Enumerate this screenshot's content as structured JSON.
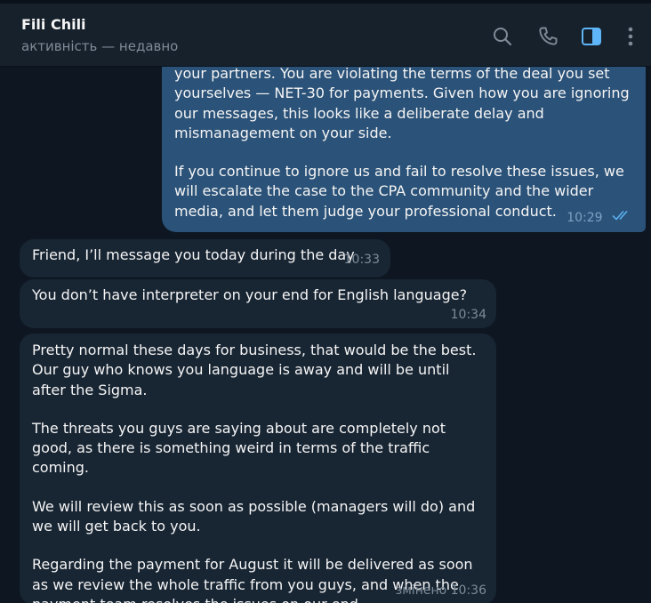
{
  "header": {
    "name": "Fili Chili",
    "status": "активність — недавно"
  },
  "messages": [
    {
      "direction": "out",
      "paragraphs": [
        "your partners. You are violating the terms of the deal you set yourselves — NET-30 for payments. Given how you are ignoring our messages, this looks like a deliberate delay and mismanagement on your side.",
        "If you continue to ignore us and fail to resolve these issues, we will escalate the case to the CPA community and the wider media, and let them judge your professional conduct."
      ],
      "time": "10:29",
      "read": true
    },
    {
      "direction": "in",
      "paragraphs": [
        "Friend, I’ll message you today during the day"
      ],
      "time": "10:33"
    },
    {
      "direction": "in",
      "paragraphs": [
        "You don’t have interpreter on your end for English language?"
      ],
      "time": "10:34"
    },
    {
      "direction": "in",
      "paragraphs": [
        "Pretty normal these days for business, that would be the best. Our guy who knows you language is away and will be until after the Sigma.",
        "The threats you guys are saying about are completely not good, as there is something weird in terms of the traffic coming.",
        "We will review this as soon as possible (managers will do) and we will get back to you.",
        "Regarding the payment for August it will be delivered as soon as we review the whole traffic from you guys, and when the payment team resolves the issues on our end"
      ],
      "time": "10:36",
      "edited_label": "змінено"
    }
  ]
}
